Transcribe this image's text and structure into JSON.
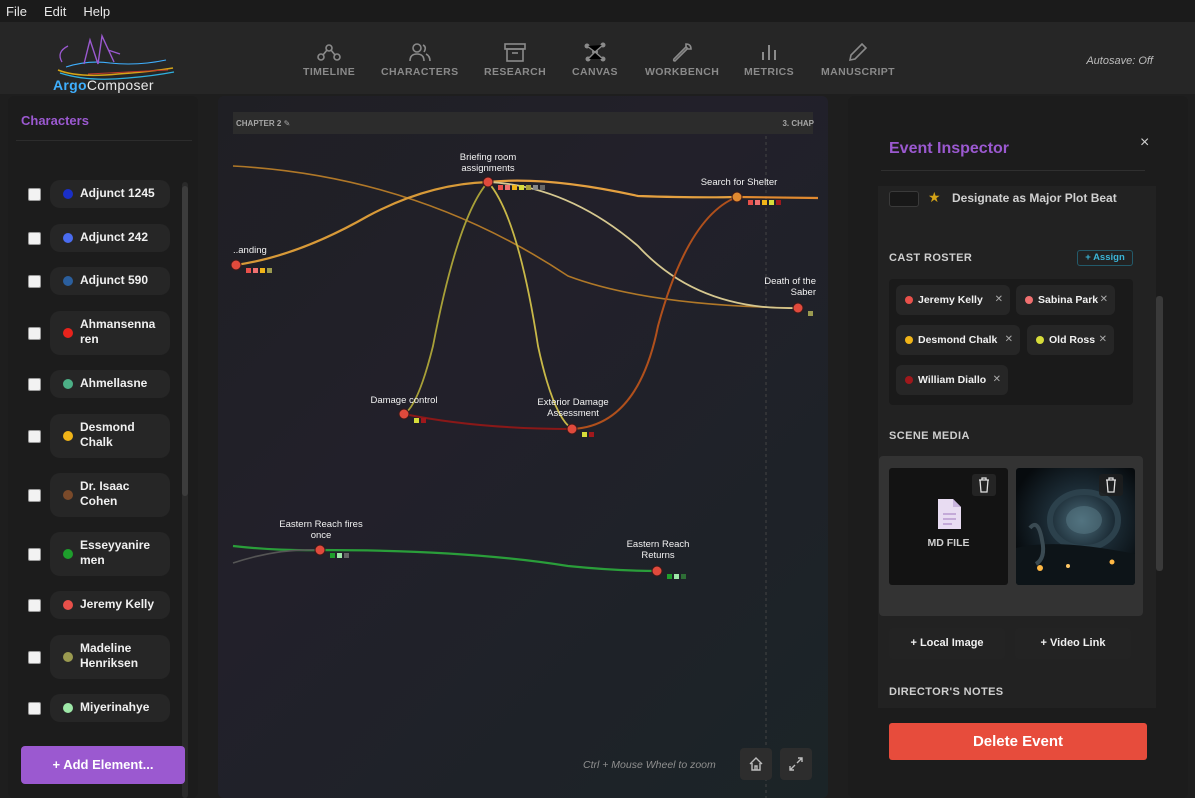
{
  "menu": {
    "items": [
      "File",
      "Edit",
      "Help"
    ]
  },
  "app": {
    "logo_part1": "Argo",
    "logo_part2": "Composer",
    "autosave": "Autosave: Off"
  },
  "nav": [
    {
      "label": "TIMELINE",
      "icon": "timeline-icon"
    },
    {
      "label": "CHARACTERS",
      "icon": "characters-icon"
    },
    {
      "label": "RESEARCH",
      "icon": "archive-box-icon"
    },
    {
      "label": "CANVAS",
      "icon": "canvas-nodes-icon"
    },
    {
      "label": "WORKBENCH",
      "icon": "wrench-icon"
    },
    {
      "label": "METRICS",
      "icon": "bar-chart-icon"
    },
    {
      "label": "MANUSCRIPT",
      "icon": "pencil-icon"
    }
  ],
  "sidebar": {
    "title": "Characters",
    "characters": [
      {
        "name": "Adjunct 1245",
        "color": "#1a2fc7"
      },
      {
        "name": "Adjunct 242",
        "color": "#4a6cf0"
      },
      {
        "name": "Adjunct 590",
        "color": "#2b5f9e"
      },
      {
        "name": "Ahmansenna ren",
        "color": "#e8231c"
      },
      {
        "name": "Ahmellasne",
        "color": "#4caf86"
      },
      {
        "name": "Desmond Chalk",
        "color": "#f0b418"
      },
      {
        "name": "Dr. Isaac Cohen",
        "color": "#7a4a2a"
      },
      {
        "name": "Esseyyanire men",
        "color": "#1e9e2c"
      },
      {
        "name": "Jeremy Kelly",
        "color": "#e8504a"
      },
      {
        "name": "Madeline Henriksen",
        "color": "#9a9a50"
      },
      {
        "name": "Miyerinahye",
        "color": "#9ee8a8"
      }
    ],
    "add_button": "+ Add Element..."
  },
  "canvas": {
    "chapter_left": "CHAPTER 2 ✎",
    "chapter_right": "3. CHAP",
    "events": [
      {
        "label": "Briefing room assignments"
      },
      {
        "label": "Search for Shelter"
      },
      {
        "label": "..anding"
      },
      {
        "label": "Death of the Saber"
      },
      {
        "label": "Damage control"
      },
      {
        "label": "Exterior Damage Assessment"
      },
      {
        "label": "Eastern Reach fires once"
      },
      {
        "label": "Eastern Reach Returns"
      }
    ],
    "zoom_hint": "Ctrl + Mouse Wheel to zoom"
  },
  "inspector": {
    "title": "Event Inspector",
    "close": "×",
    "major_beat_label": "Designate as Major Plot Beat",
    "cast_title": "CAST ROSTER",
    "assign_label": "+ Assign",
    "cast": [
      {
        "name": "Jeremy Kelly",
        "color": "#e8504a"
      },
      {
        "name": "Sabina Park",
        "color": "#f07070"
      },
      {
        "name": "Desmond Chalk",
        "color": "#f0b418"
      },
      {
        "name": "Old Ross",
        "color": "#d6dc3a"
      },
      {
        "name": "William Diallo",
        "color": "#a0181c"
      }
    ],
    "media_title": "SCENE MEDIA",
    "md_file_label": "MD FILE",
    "local_image": "+ Local Image",
    "video_link": "+ Video Link",
    "notes_title": "DIRECTOR'S NOTES",
    "delete_label": "Delete Event"
  }
}
